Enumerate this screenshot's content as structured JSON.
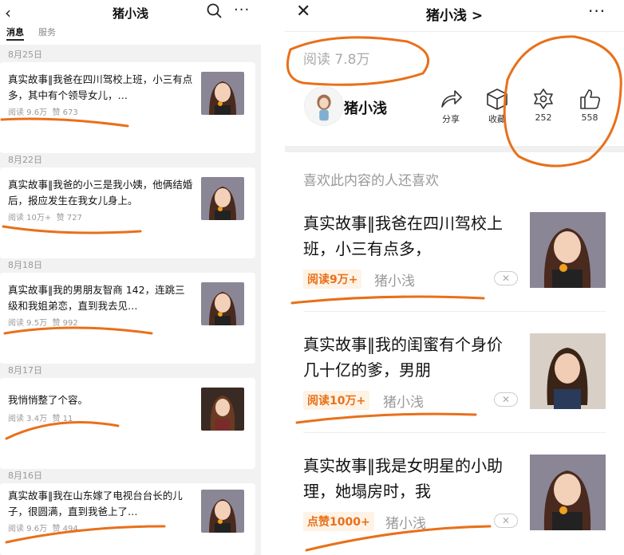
{
  "left": {
    "title": "猪小浅",
    "back_icon": "‹",
    "tabs": [
      {
        "label": "消息"
      },
      {
        "label": "服务"
      }
    ],
    "articles": [
      {
        "date": "8月25日",
        "title": "真实故事‖我爸在四川驾校上班，小三有点多，其中有个领导女儿，…",
        "reads": "阅读 9.6万",
        "likes": "赞 673"
      },
      {
        "date": "8月22日",
        "title": "真实故事‖我爸的小三是我小姨，他俩结婚后，报应发生在我女儿身上。",
        "reads": "阅读 10万+",
        "likes": "赞 727"
      },
      {
        "date": "8月18日",
        "title": "真实故事‖我的男朋友智商 142，连跳三级和我姐弟恋，直到我去见…",
        "reads": "阅读 9.5万",
        "likes": "赞 992"
      },
      {
        "date": "8月17日",
        "title": "我悄悄整了个容。",
        "reads": "阅读 3.4万",
        "likes": "赞 11"
      },
      {
        "date": "8月16日",
        "title": "真实故事‖我在山东嫁了电视台台长的儿子，很圆满，直到我爸上了…",
        "reads": "阅读 9.6万",
        "likes": "赞 494"
      }
    ]
  },
  "right": {
    "title": "猪小浅 >",
    "reads": "阅读 7.8万",
    "author": "猪小浅",
    "actions": [
      {
        "label": "分享",
        "icon": "share-icon"
      },
      {
        "label": "收藏",
        "icon": "cube-icon"
      },
      {
        "label": "252",
        "icon": "flower-icon"
      },
      {
        "label": "558",
        "icon": "thumb-up-icon"
      }
    ],
    "rec_header": "喜欢此内容的人还喜欢",
    "recs": [
      {
        "title": "真实故事‖我爸在四川驾校上班，小三有点多，",
        "badge": "阅读9万+",
        "author": "猪小浅",
        "close": "✕"
      },
      {
        "title": "真实故事‖我的闺蜜有个身价几十亿的爹，男朋",
        "badge": "阅读10万+",
        "author": "猪小浅",
        "close": "✕"
      },
      {
        "title": "真实故事‖我是女明星的小助理，她塌房时，我",
        "badge": "点赞1000+",
        "author": "猪小浅",
        "close": "✕"
      }
    ]
  },
  "colors": {
    "accent": "#e8701a",
    "annotation": "#e8701a"
  }
}
